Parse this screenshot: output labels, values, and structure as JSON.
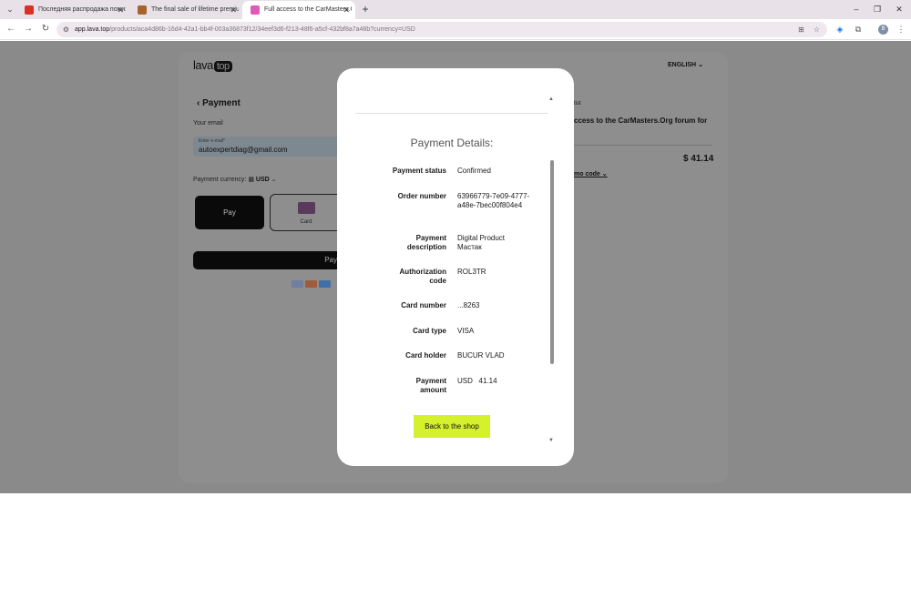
{
  "browser": {
    "tabs": [
      {
        "title": "Последняя распродажа пожиз",
        "favicon_color": "#d93025"
      },
      {
        "title": "The final sale of lifetime premiu",
        "favicon_color": "#a5652a"
      },
      {
        "title": "Full access to the CarMasters.O",
        "favicon_color": "#e05bb8"
      }
    ],
    "new_tab": "+",
    "url_host": "app.lava.top",
    "url_path": "/products/aca4d86b-16d4-42a1-bb4f-003a36873f12/34eef3d6-f213-48f6-a5cf-432bf8a7a48b?currency=USD",
    "profile_initial": "B"
  },
  "page": {
    "logo_text": "lava",
    "logo_box": "top",
    "language": "ENGLISH",
    "back_title": "Payment",
    "email_label": "Your email",
    "email_placeholder": "Enter e-mail*",
    "email_value": "autoexpertdiag@gmail.com",
    "currency_label": "Payment currency:",
    "currency_value": "USD",
    "apple_pay_label": "Pay",
    "card_label": "Card",
    "pay_button": "Pay",
    "right_small": "tist",
    "right_title": "ccess to the CarMasters.Org forum for",
    "price": "$ 41.14",
    "promo": "mo code"
  },
  "modal": {
    "title": "Payment Details:",
    "details": [
      {
        "label": "Payment status",
        "value": "Confirmed"
      },
      {
        "label": "Order number",
        "value": "63966779-7e09-4777-a48e-7bec00f804e4"
      },
      {
        "label": "Payment description",
        "value": "Digital Product Мастак"
      },
      {
        "label": "Authorization code",
        "value": "ROL3TR"
      },
      {
        "label": "Card number",
        "value": "...8263"
      },
      {
        "label": "Card type",
        "value": "VISA"
      },
      {
        "label": "Card holder",
        "value": "BUCUR VLAD"
      },
      {
        "label": "Payment amount",
        "value": "USD   41.14"
      }
    ],
    "back_button": "Back to the shop"
  },
  "colors": {
    "accent_button": "#d5f02d",
    "overlay": "#8a8a8a"
  }
}
